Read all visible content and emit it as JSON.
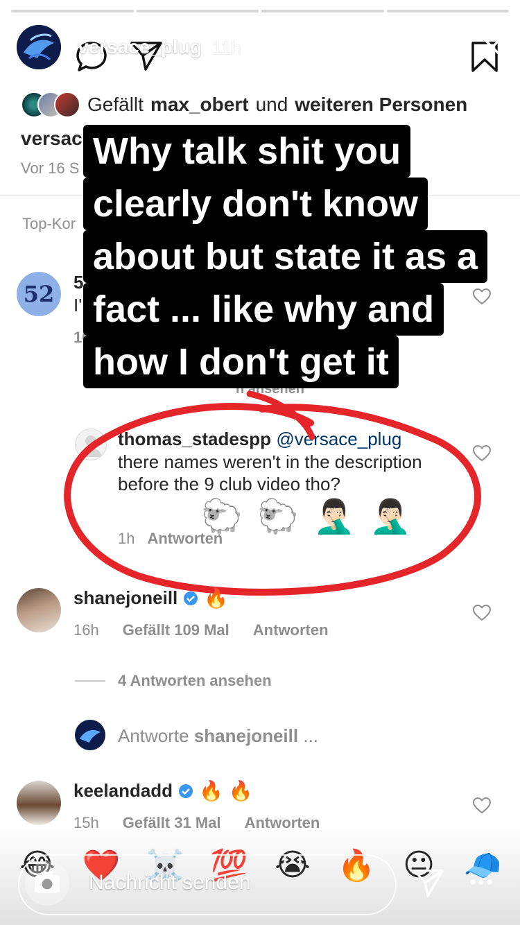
{
  "header": {
    "username": "versace_plug",
    "time": "11h"
  },
  "post": {
    "likes_prefix": "Gefällt",
    "likes_user": "max_obert",
    "likes_mid": "und",
    "likes_rest": "weiteren Personen",
    "caption_user": "versac",
    "caption_time": "Vor 16 S",
    "top_comments_label": "Top-Kor"
  },
  "comments": [
    {
      "avatar_text": "52",
      "user_fragment": "5",
      "text_fragment": "I'",
      "meta_fragment": "16",
      "replies_fragment": "n ansehen"
    },
    {
      "user": "thomas_stadespp",
      "mention": "@versace_plug",
      "text": "there names weren't in the description before the 9 club video tho?",
      "emojis": "🐑 🐑 🤦🏻‍♂️ 🤦🏻‍♂️",
      "meta_time": "1h",
      "meta_reply": "Antworten"
    },
    {
      "user": "shanejoneill",
      "emoji": "🔥",
      "meta_time": "16h",
      "meta_likes": "Gefällt 109 Mal",
      "meta_reply": "Antworten",
      "view_replies": "4 Antworten ansehen",
      "reply_prompt_prefix": "Antworte",
      "reply_prompt_user": "shanejoneill",
      "reply_prompt_suffix": "..."
    },
    {
      "user": "keelandadd",
      "emoji": "🔥 🔥",
      "meta_time": "15h",
      "meta_likes": "Gefällt 31 Mal",
      "meta_reply": "Antworten"
    }
  ],
  "overlay": {
    "lines": [
      "Why talk shit you",
      "clearly don't know",
      "about but state it as a",
      "fact ... like why and",
      "how I don't get it"
    ]
  },
  "bottom": {
    "reactions": [
      "😂",
      "❤️",
      "☠️",
      "💯",
      "😭",
      "🔥",
      "😐",
      "🧢"
    ],
    "message_placeholder": "Nachricht senden"
  },
  "colors": {
    "annotation_red": "#e4252a",
    "verified_blue": "#3897f0",
    "meta_grey": "#8e8e8e"
  },
  "icons": [
    "comment-icon",
    "send-icon",
    "bookmark-icon",
    "close-icon",
    "heart-icon",
    "camera-icon",
    "more-icon",
    "verified-icon"
  ]
}
